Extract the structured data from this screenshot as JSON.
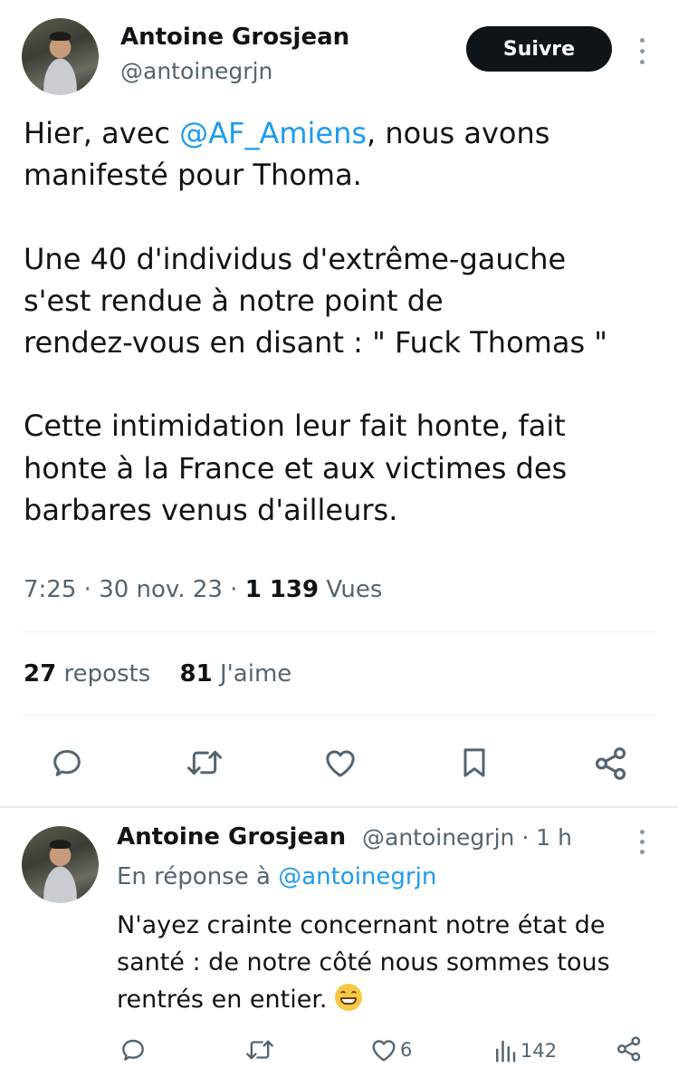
{
  "tweet": {
    "author_name": "Antoine Grosjean",
    "author_handle": "@antoinegrjn",
    "follow_label": "Suivre",
    "text": {
      "line1_before": "Hier, avec ",
      "line1_mention": "@AF_Amiens",
      "line1_after": ", nous avons",
      "line2": "manifesté pour Thoma.",
      "line3": "Une 40 d'individus d'extrême-gauche",
      "line4": "s'est rendue à notre point de",
      "line5": "rendez-vous en disant : \" Fuck Thomas \"",
      "line6": "Cette intimidation leur fait honte, fait",
      "line7": "honte à la France et aux victimes des",
      "line8": "barbares venus d'ailleurs."
    },
    "time": "7:25",
    "date": "30 nov. 23",
    "views_count": "1 139",
    "views_label": "Vues",
    "reposts_count": "27",
    "reposts_label": "reposts",
    "likes_count": "81",
    "likes_label": "J'aime",
    "separator": "·"
  },
  "reply": {
    "author_name": "Antoine Grosjean",
    "author_handle": "@antoinegrjn",
    "time_ago": "1 h",
    "in_reply_prefix": "En réponse à",
    "in_reply_handle": "@antoinegrjn",
    "text_line1": "N'ayez crainte concernant notre état de",
    "text_line2": "santé : de notre côté nous sommes tous",
    "text_line3": "rentrés en entier.",
    "emoji": "grinning-face-emoji",
    "likes_count": "6",
    "views_count": "142"
  },
  "colors": {
    "text": "#0f1419",
    "secondary": "#536471",
    "link": "#1d9bf0",
    "button_bg": "#0f1419",
    "divider": "#eff3f4"
  },
  "icons": [
    "reply-icon",
    "repost-icon",
    "like-icon",
    "bookmark-icon",
    "share-icon",
    "views-icon",
    "more-icon"
  ]
}
